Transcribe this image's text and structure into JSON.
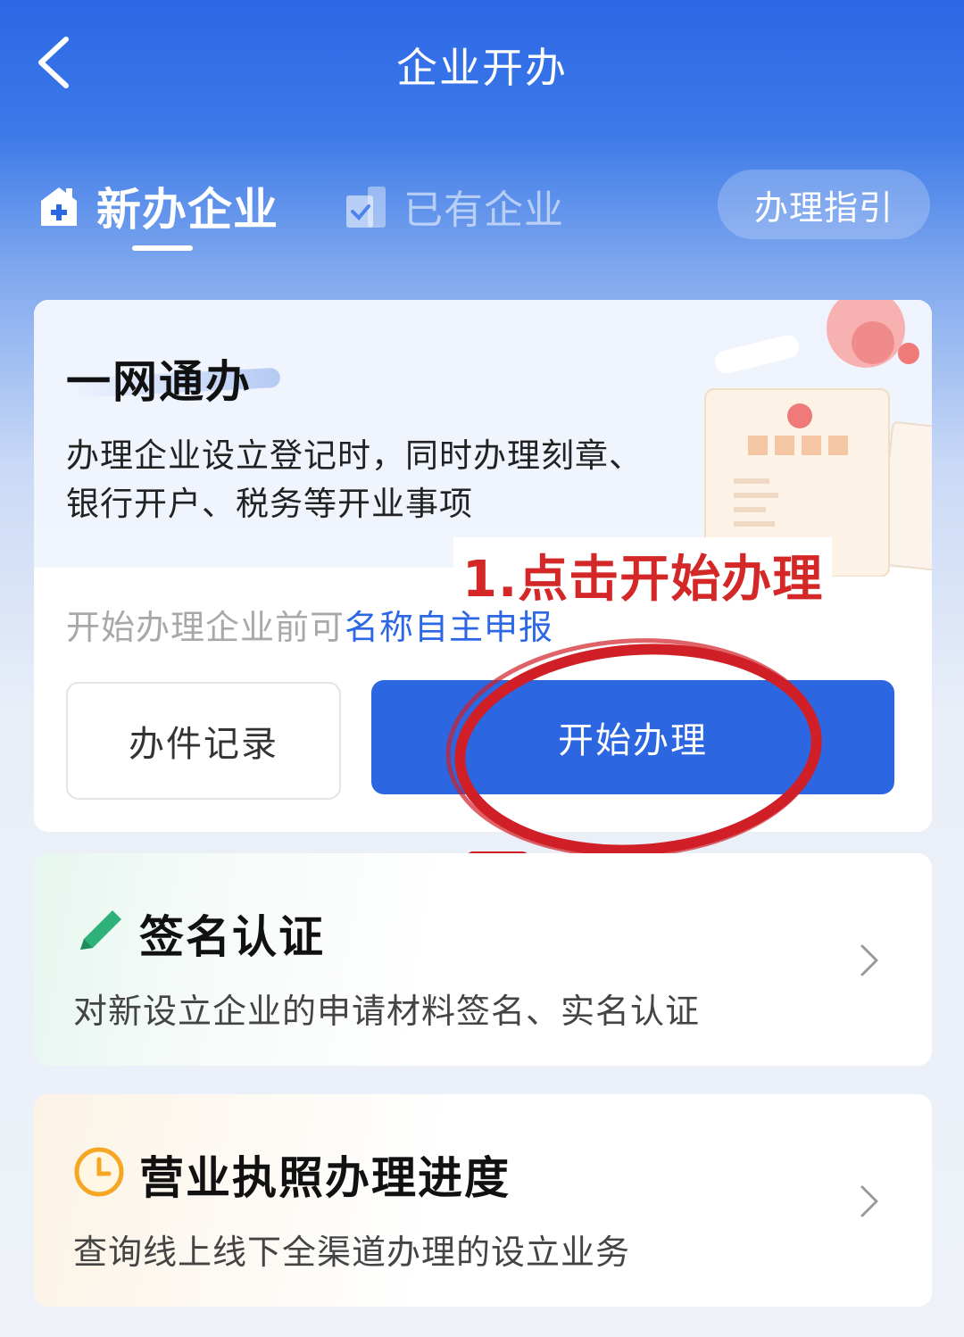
{
  "header": {
    "title": "企业开办"
  },
  "tabs": {
    "new_company": "新办企业",
    "existing_company": "已有企业",
    "guide_button": "办理指引"
  },
  "main_card": {
    "title": "一网通办",
    "description": "办理企业设立登记时，同时办理刻章、银行开户、税务等开业事项",
    "hint_prefix": "开始办理企业前可",
    "hint_link": "名称自主申报",
    "records_button": "办件记录",
    "start_button": "开始办理",
    "annotation": "1.点击开始办理"
  },
  "cards": [
    {
      "title": "签名认证",
      "description": "对新设立企业的申请材料签名、实名认证",
      "icon": "pencil-icon"
    },
    {
      "title": "营业执照办理进度",
      "description": "查询线上线下全渠道办理的设立业务",
      "icon": "clock-icon"
    }
  ],
  "colors": {
    "primary": "#2c66e0",
    "annotation_red": "#d42727",
    "green_icon": "#2fb27a",
    "orange_icon": "#f5a623"
  }
}
